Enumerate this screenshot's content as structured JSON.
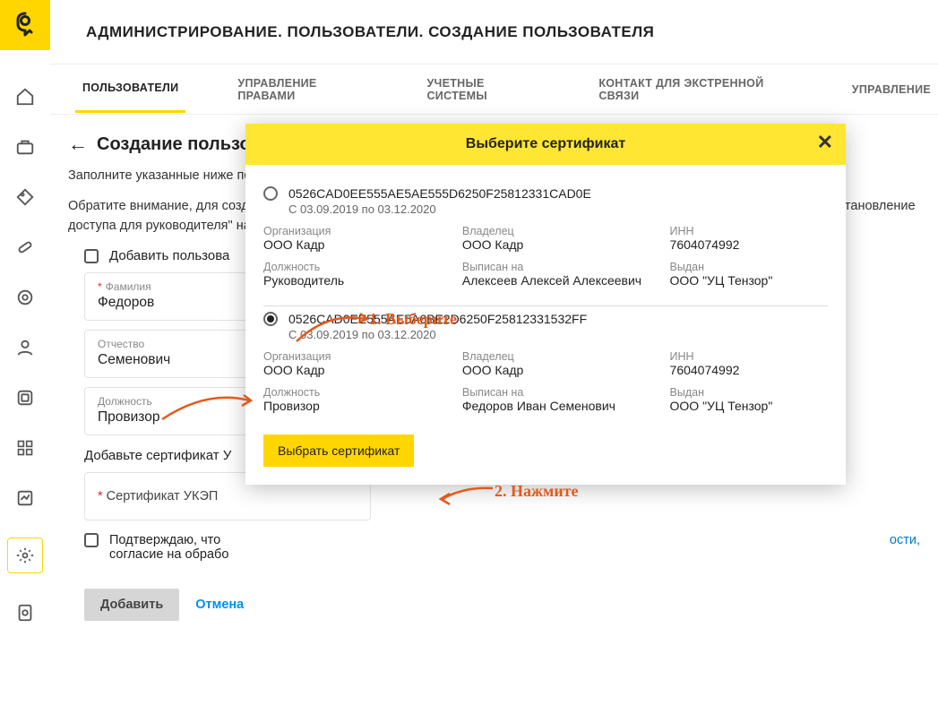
{
  "header": {
    "title": "АДМИНИСТРИРОВАНИЕ. ПОЛЬЗОВАТЕЛИ. СОЗДАНИЕ ПОЛЬЗОВАТЕЛЯ"
  },
  "tabs": {
    "users": "ПОЛЬЗОВАТЕЛИ",
    "rights": "УПРАВЛЕНИЕ ПРАВАМИ",
    "systems": "УЧЕТНЫЕ СИСТЕМЫ",
    "contact": "КОНТАКТ ДЛЯ ЭКСТРЕННОЙ СВЯЗИ",
    "manage": "УПРАВЛЕНИЕ"
  },
  "page": {
    "title": "Создание пользователя",
    "intro1": "Заполните указанные ниже поля для добавления нового пользователя в систему.",
    "intro2": "Обратите внимание, для создания пользователя - руководителя организации вам необходимо воспользоваться функцией \"Восстановление доступа для руководителя\" на странице авторизации.",
    "add_no_cert": "Добавить пользова",
    "surname_label": "Фамилия",
    "surname": "Федоров",
    "patronymic_label": "Отчество",
    "patronymic": "Семенович",
    "position_label": "Должность",
    "position": "Провизор",
    "add_cert": "Добавьте сертификат У",
    "cert_label": "Сертификат УКЭП",
    "confirm1": "Подтверждаю, что",
    "confirm2": "согласие на обрабо",
    "link_tail": "ости,",
    "add_btn": "Добавить",
    "cancel_btn": "Отмена"
  },
  "modal": {
    "title": "Выберите сертификат",
    "certs": [
      {
        "id": "0526CAD0EE555AE5AE555D6250F25812331CAD0E",
        "dates": "С 03.09.2019 по 03.12.2020",
        "org_l": "Организация",
        "org": "ООО Кадр",
        "owner_l": "Владелец",
        "owner": "ООО Кадр",
        "inn_l": "ИНН",
        "inn": "7604074992",
        "pos_l": "Должность",
        "pos": "Руководитель",
        "issued_to_l": "Выписан на",
        "issued_to": "Алексеев Алексей Алексеевич",
        "issued_by_l": "Выдан",
        "issued_by": "ООО \"УЦ Тензор\"",
        "selected": false
      },
      {
        "id": "0526CAD0EE555AE5A6BE2D6250F25812331532FF",
        "dates": "С 03.09.2019 по 03.12.2020",
        "org_l": "Организация",
        "org": "ООО Кадр",
        "owner_l": "Владелец",
        "owner": "ООО Кадр",
        "inn_l": "ИНН",
        "inn": "7604074992",
        "pos_l": "Должность",
        "pos": "Провизор",
        "issued_to_l": "Выписан на",
        "issued_to": "Федоров Иван Семенович",
        "issued_by_l": "Выдан",
        "issued_by": "ООО \"УЦ Тензор\"",
        "selected": true
      }
    ],
    "select_btn": "Выбрать сертификат"
  },
  "anno": {
    "step1": "1. Выберите",
    "step2": "2. Нажмите"
  }
}
